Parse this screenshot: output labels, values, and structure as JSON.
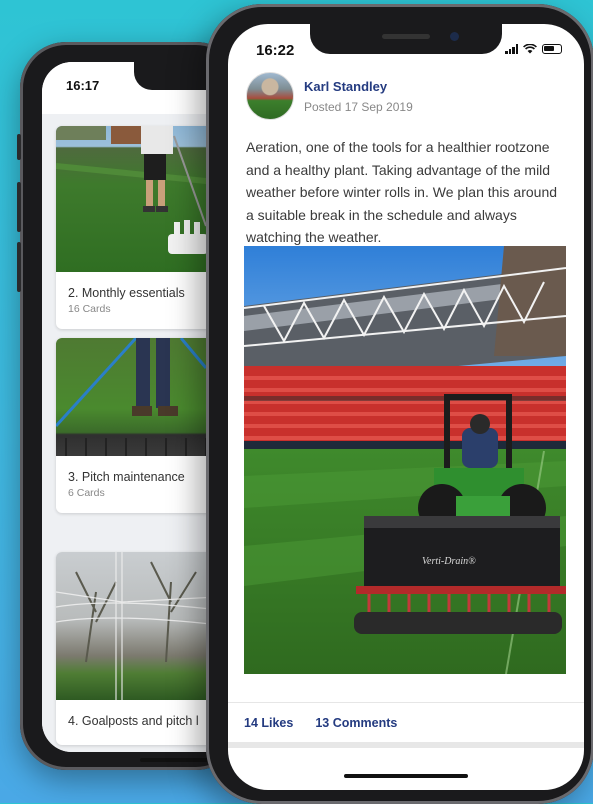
{
  "back_screen": {
    "time": "16:17",
    "cards": [
      {
        "title": "2. Monthly essentials",
        "subtitle": "16 Cards"
      },
      {
        "title": "3. Pitch maintenance",
        "subtitle": "6 Cards"
      },
      {
        "title": "4. Goalposts and pitch l",
        "subtitle": ""
      }
    ]
  },
  "front_screen": {
    "time": "16:22",
    "post": {
      "author": "Karl Standley",
      "posted": "Posted 17 Sep 2019",
      "text": "Aeration, one of the tools for a healthier rootzone and a healthy plant. Taking advantage of the mild weather before winter rolls in. We plan this around a suitable break in the schedule and always watching the weather.",
      "machine_brand": "Verti-Drain®",
      "likes": "14 Likes",
      "comments": "13 Comments"
    }
  },
  "colors": {
    "background": "#38bede",
    "accent_text": "#243b80",
    "phone_frame": "#1a1a1c"
  }
}
